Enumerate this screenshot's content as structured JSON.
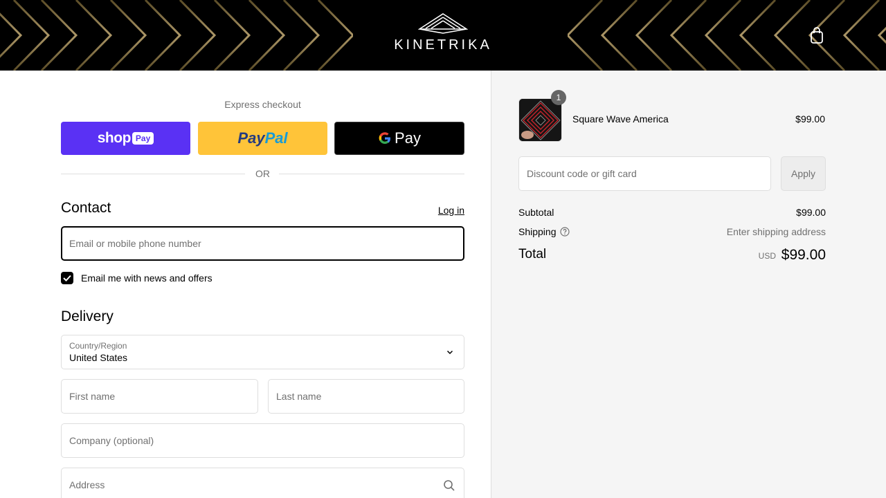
{
  "header": {
    "brand": "KINETRIKA",
    "cart_icon": "shopping-bag-icon"
  },
  "express": {
    "label": "Express checkout",
    "shop_text": "shop",
    "shop_pill": "Pay",
    "paypal_pay": "Pay",
    "paypal_pal": "Pal",
    "gpay_text": "Pay",
    "or": "OR"
  },
  "contact": {
    "title": "Contact",
    "login": "Log in",
    "email_placeholder": "Email or mobile phone number",
    "news_label": "Email me with news and offers",
    "news_checked": true
  },
  "delivery": {
    "title": "Delivery",
    "country_label": "Country/Region",
    "country_value": "United States",
    "first_name_placeholder": "First name",
    "last_name_placeholder": "Last name",
    "company_placeholder": "Company (optional)",
    "address_placeholder": "Address"
  },
  "summary": {
    "item": {
      "name": "Square Wave America",
      "price": "$99.00",
      "quantity": "1"
    },
    "discount_placeholder": "Discount code or gift card",
    "apply": "Apply",
    "subtotal_label": "Subtotal",
    "subtotal_value": "$99.00",
    "shipping_label": "Shipping",
    "shipping_value": "Enter shipping address",
    "total_label": "Total",
    "currency": "USD",
    "total_value": "$99.00"
  },
  "colors": {
    "shop_pay": "#5a31f4",
    "paypal": "#ffc439",
    "gpay": "#000000",
    "header": "#000000",
    "sidebar_bg": "#f5f5f5"
  }
}
